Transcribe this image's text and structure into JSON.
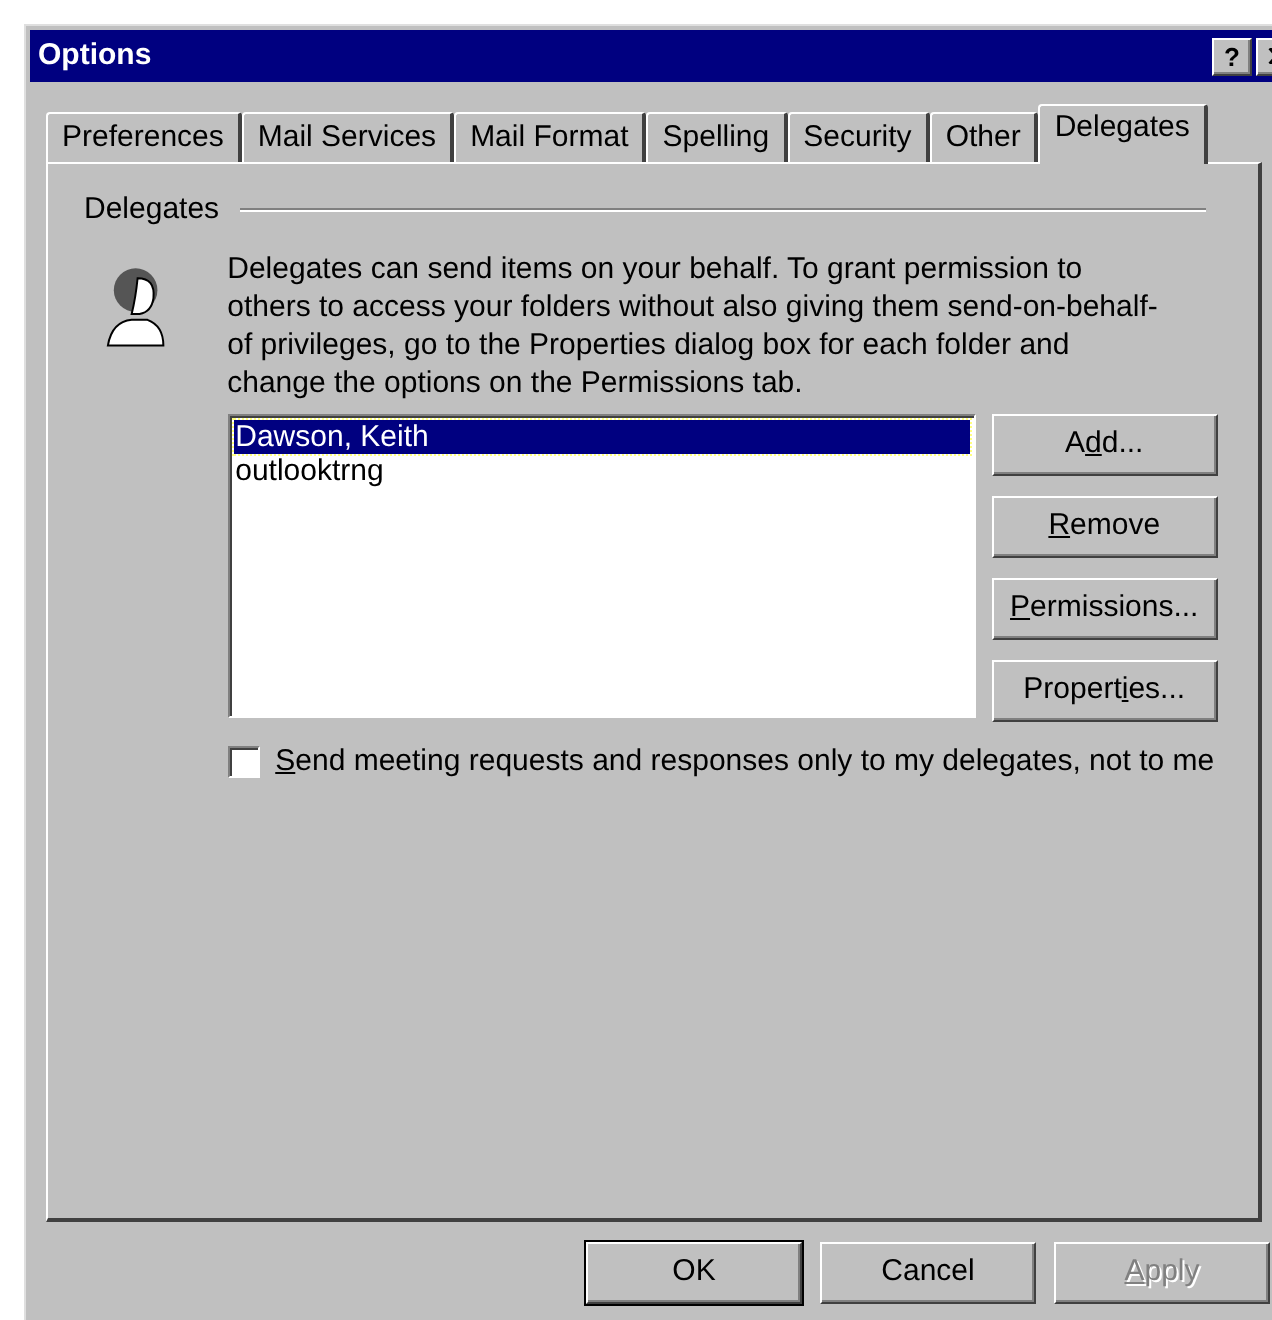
{
  "window": {
    "title": "Options",
    "help_button": "?"
  },
  "tabs": [
    {
      "label": "Preferences",
      "selected": false
    },
    {
      "label": "Mail Services",
      "selected": false
    },
    {
      "label": "Mail Format",
      "selected": false
    },
    {
      "label": "Spelling",
      "selected": false
    },
    {
      "label": "Security",
      "selected": false
    },
    {
      "label": "Other",
      "selected": false
    },
    {
      "label": "Delegates",
      "selected": true
    }
  ],
  "group": {
    "title": "Delegates",
    "description": "Delegates can send items on your behalf. To grant permission to others to access your folders without also giving them send-on-behalf-of privileges, go to the Properties dialog box for each folder and change the options on the Permissions tab."
  },
  "delegates": [
    {
      "name": "Dawson, Keith",
      "selected": true
    },
    {
      "name": "outlooktrng",
      "selected": false
    }
  ],
  "side_buttons": [
    {
      "label": {
        "before": "A",
        "key": "d",
        "after": "d..."
      },
      "disabled": false
    },
    {
      "label": {
        "key": "R",
        "after": "emove"
      },
      "disabled": false
    },
    {
      "label": {
        "key": "P",
        "after": "ermissions..."
      },
      "disabled": false
    },
    {
      "label": {
        "before": "Propert",
        "key": "i",
        "after": "es..."
      },
      "disabled": false
    }
  ],
  "option": {
    "label": {
      "key": "S",
      "after": "end meeting requests and responses only to my delegates, not to me"
    },
    "checked": false
  },
  "footer_buttons": [
    {
      "label": {
        "after": "OK"
      },
      "disabled": false,
      "default": true
    },
    {
      "label": {
        "after": "Cancel"
      },
      "disabled": false,
      "default": false
    },
    {
      "label": {
        "key": "A",
        "after": "pply"
      },
      "disabled": true,
      "default": false
    }
  ]
}
